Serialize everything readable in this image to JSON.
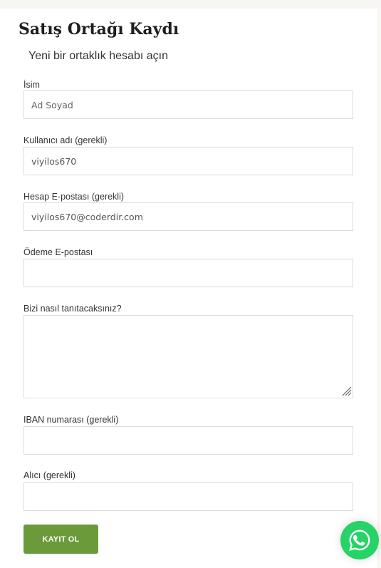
{
  "form": {
    "title": "Satış Ortağı Kaydı",
    "subtitle": "Yeni bir ortaklık hesabı açın",
    "name": {
      "label": "İsim",
      "placeholder": "Ad Soyad",
      "value": ""
    },
    "username": {
      "label": "Kullanıcı adı (gerekli)",
      "value": "viyilos670"
    },
    "account_email": {
      "label": "Hesap E-postası (gerekli)",
      "value": "viyilos670@coderdir.com"
    },
    "payment_email": {
      "label": "Ödeme E-postası",
      "value": ""
    },
    "promotion": {
      "label": "Bizi nasıl tanıtacaksınız?",
      "value": ""
    },
    "iban": {
      "label": "IBAN numarası (gerekli)",
      "value": ""
    },
    "recipient": {
      "label": "Alıcı (gerekli)",
      "value": ""
    },
    "submit_label": "KAYIT OL"
  },
  "widgets": {
    "whatsapp_icon": "whatsapp-icon",
    "whatsapp_color": "#25d366"
  },
  "theme": {
    "accent": "#6a9a3a"
  }
}
